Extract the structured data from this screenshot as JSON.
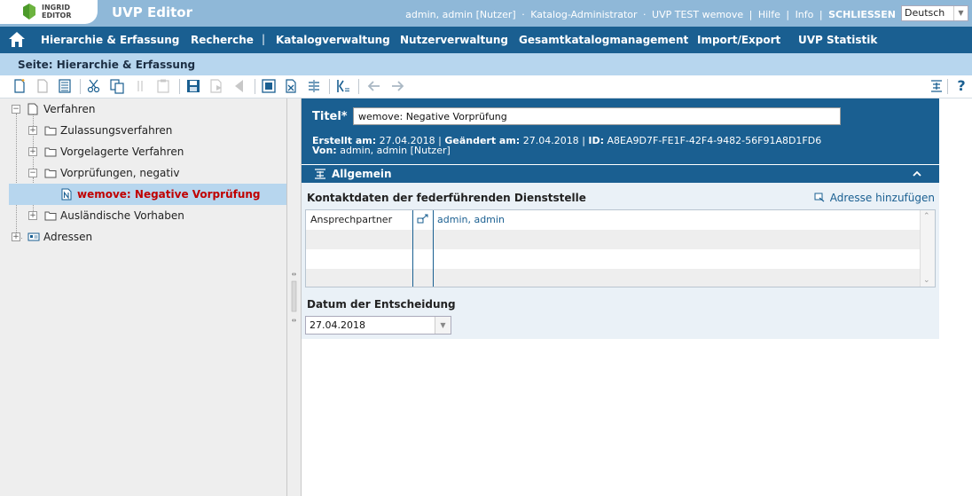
{
  "app": {
    "logo_text_line1": "INGRID",
    "logo_text_line2": "EDITOR",
    "title": "UVP Editor"
  },
  "header": {
    "user": "admin, admin [Nutzer]",
    "role": "Katalog-Administrator",
    "catalog": "UVP TEST wemove",
    "help": "Hilfe",
    "info": "Info",
    "close": "SCHLIESSEN",
    "separator_dot": "·",
    "separator_bar": "|",
    "language": "Deutsch"
  },
  "nav": {
    "items": [
      "Hierarchie & Erfassung",
      "Recherche",
      "Katalogverwaltung",
      "Nutzerverwaltung",
      "Gesamtkatalogmanagement",
      "Import/Export",
      "UVP Statistik"
    ],
    "separator": "|"
  },
  "page": {
    "label": "Seite: Hierarchie & Erfassung"
  },
  "toolbar": {
    "icons": [
      "new-document-icon",
      "new-copy-icon",
      "document-view-icon",
      "cut-icon",
      "copy-icon",
      "copy-disabled-icon",
      "paste-icon",
      "save-icon",
      "discard-icon",
      "back-icon",
      "preview-icon",
      "delete-icon",
      "move-icon",
      "comment-icon",
      "arrow-left-icon",
      "arrow-right-icon",
      "expand-all-icon",
      "help-icon"
    ],
    "help_label": "?"
  },
  "tree": {
    "items": [
      {
        "label": "Verfahren",
        "toggle": "−"
      },
      {
        "label": "Zulassungsverfahren",
        "toggle": "+"
      },
      {
        "label": "Vorgelagerte Verfahren",
        "toggle": "+"
      },
      {
        "label": "Vorprüfungen, negativ",
        "toggle": "−"
      },
      {
        "label": "wemove: Negative Vorprüfung",
        "toggle": ""
      },
      {
        "label": "Ausländische Vorhaben",
        "toggle": "+"
      },
      {
        "label": "Adressen",
        "toggle": "+"
      }
    ],
    "selected_color": "#c00000"
  },
  "detail": {
    "title_label": "Titel*",
    "title_value": "wemove: Negative Vorprüfung",
    "created_label": "Erstellt am:",
    "created_value": "27.04.2018",
    "changed_label": "Geändert am:",
    "changed_value": "27.04.2018",
    "id_label": "ID:",
    "id_value": "A8EA9D7F-FE1F-42F4-9482-56F91A8D1FD6",
    "meta_sep": "|",
    "owner_label": "Von:",
    "owner_value": "admin, admin [Nutzer]",
    "section_title": "Allgemein",
    "kontakt_title": "Kontaktdaten der federführenden Dienststelle",
    "add_address": "Adresse hinzufügen",
    "contacts": [
      {
        "type": "Ansprechpartner",
        "name": "admin, admin"
      },
      {
        "type": "",
        "name": ""
      },
      {
        "type": "",
        "name": ""
      },
      {
        "type": "",
        "name": ""
      }
    ],
    "datum_title": "Datum der Entscheidung",
    "datum_value": "27.04.2018"
  },
  "colors": {
    "header_light": "#8fb8d8",
    "nav_dark": "#1a5f91",
    "page_bar": "#b7d6ee",
    "tree_bg": "#eeeeee",
    "link_blue": "#1a5f91"
  }
}
